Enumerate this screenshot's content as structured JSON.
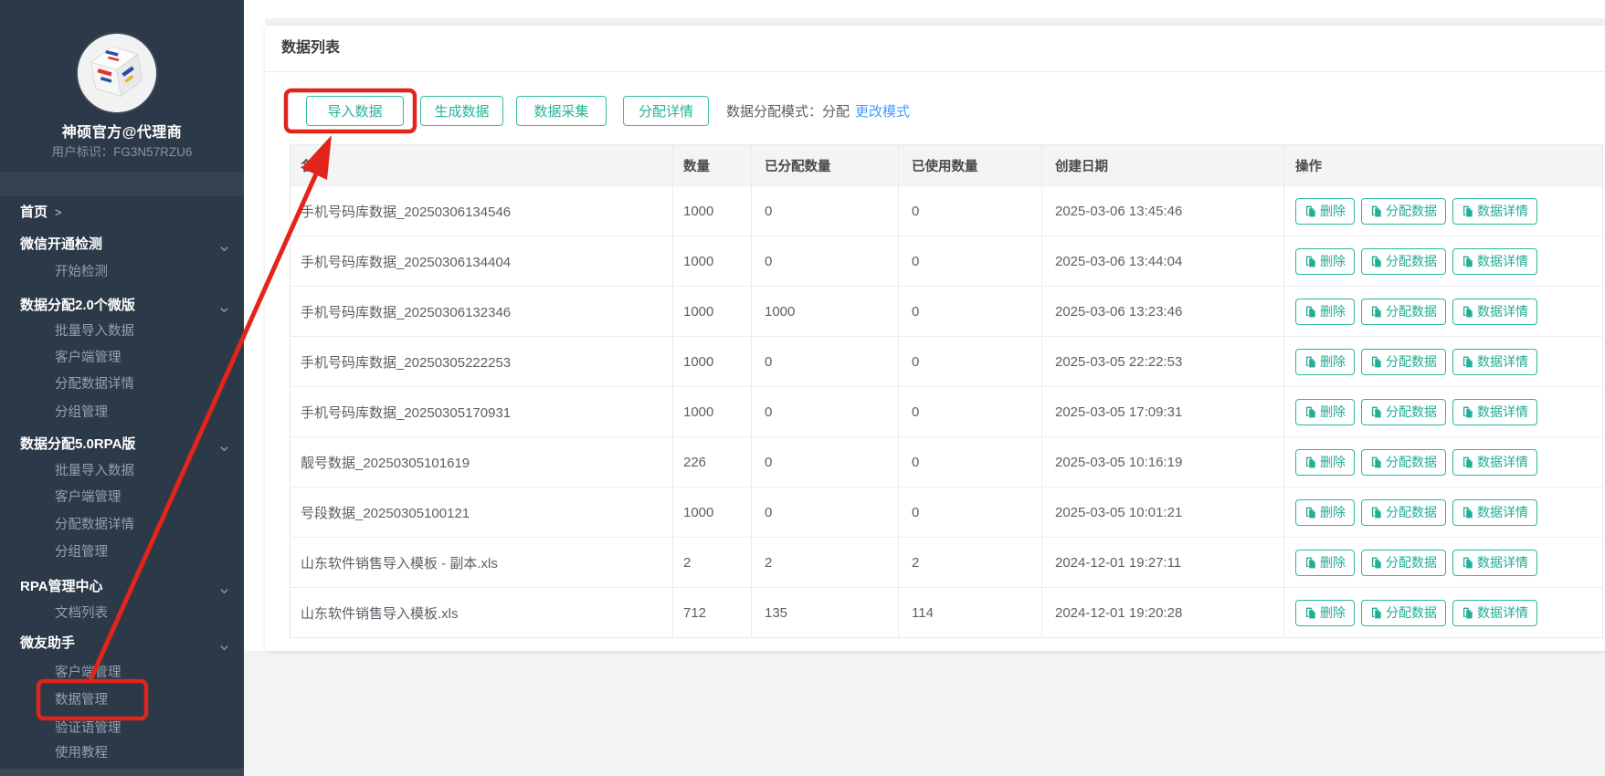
{
  "app": {
    "accent_teal": "#26b298",
    "link_blue": "#409eff",
    "annotation_red": "#e1251b",
    "sidebar_bg": "#2b3948"
  },
  "sidebar": {
    "user_name": "神硕官方@代理商",
    "user_id_label": "用户标识：",
    "user_id_value": "FG3N57RZU6",
    "menu": [
      {
        "label": "首页",
        "suffix": ">"
      },
      {
        "label": "微信开通检测"
      },
      {
        "label": "开始检测"
      },
      {
        "label": "数据分配2.0个微版"
      },
      {
        "label": "批量导入数据"
      },
      {
        "label": "客户端管理"
      },
      {
        "label": "分配数据详情"
      },
      {
        "label": "分组管理"
      },
      {
        "label": "数据分配5.0RPA版"
      },
      {
        "label": "批量导入数据"
      },
      {
        "label": "客户端管理"
      },
      {
        "label": "分配数据详情"
      },
      {
        "label": "分组管理"
      },
      {
        "label": "RPA管理中心"
      },
      {
        "label": "文档列表"
      },
      {
        "label": "微友助手"
      },
      {
        "label": "客户端管理"
      },
      {
        "label": "数据管理"
      },
      {
        "label": "验证语管理"
      },
      {
        "label": "使用教程"
      }
    ]
  },
  "card": {
    "title": "数据列表",
    "toolbar_buttons": [
      "导入数据",
      "生成数据",
      "数据采集",
      "分配详情"
    ],
    "mode_label": "数据分配模式：",
    "mode_value": "分配",
    "mode_link": "更改模式"
  },
  "table": {
    "headers": [
      "名称",
      "数量",
      "已分配数量",
      "已使用数量",
      "创建日期",
      "操作"
    ],
    "action_labels": [
      "删除",
      "分配数据",
      "数据详情"
    ],
    "rows": [
      {
        "name": "手机号码库数据_20250306134546",
        "qty": "1000",
        "allocated": "0",
        "used": "0",
        "created": "2025-03-06 13:45:46"
      },
      {
        "name": "手机号码库数据_20250306134404",
        "qty": "1000",
        "allocated": "0",
        "used": "0",
        "created": "2025-03-06 13:44:04"
      },
      {
        "name": "手机号码库数据_20250306132346",
        "qty": "1000",
        "allocated": "1000",
        "used": "0",
        "created": "2025-03-06 13:23:46"
      },
      {
        "name": "手机号码库数据_20250305222253",
        "qty": "1000",
        "allocated": "0",
        "used": "0",
        "created": "2025-03-05 22:22:53"
      },
      {
        "name": "手机号码库数据_20250305170931",
        "qty": "1000",
        "allocated": "0",
        "used": "0",
        "created": "2025-03-05 17:09:31"
      },
      {
        "name": "靓号数据_20250305101619",
        "qty": "226",
        "allocated": "0",
        "used": "0",
        "created": "2025-03-05 10:16:19"
      },
      {
        "name": "号段数据_20250305100121",
        "qty": "1000",
        "allocated": "0",
        "used": "0",
        "created": "2025-03-05 10:01:21"
      },
      {
        "name": "山东软件销售导入模板 - 副本.xls",
        "qty": "2",
        "allocated": "2",
        "used": "2",
        "created": "2024-12-01 19:27:11"
      },
      {
        "name": "山东软件销售导入模板.xls",
        "qty": "712",
        "allocated": "135",
        "used": "114",
        "created": "2024-12-01 19:20:28"
      }
    ]
  },
  "annotations": {
    "highlighted_button": "导入数据",
    "highlighted_menu_item": "数据管理",
    "arrow": "from 数据管理 menu item to 导入数据 button"
  }
}
